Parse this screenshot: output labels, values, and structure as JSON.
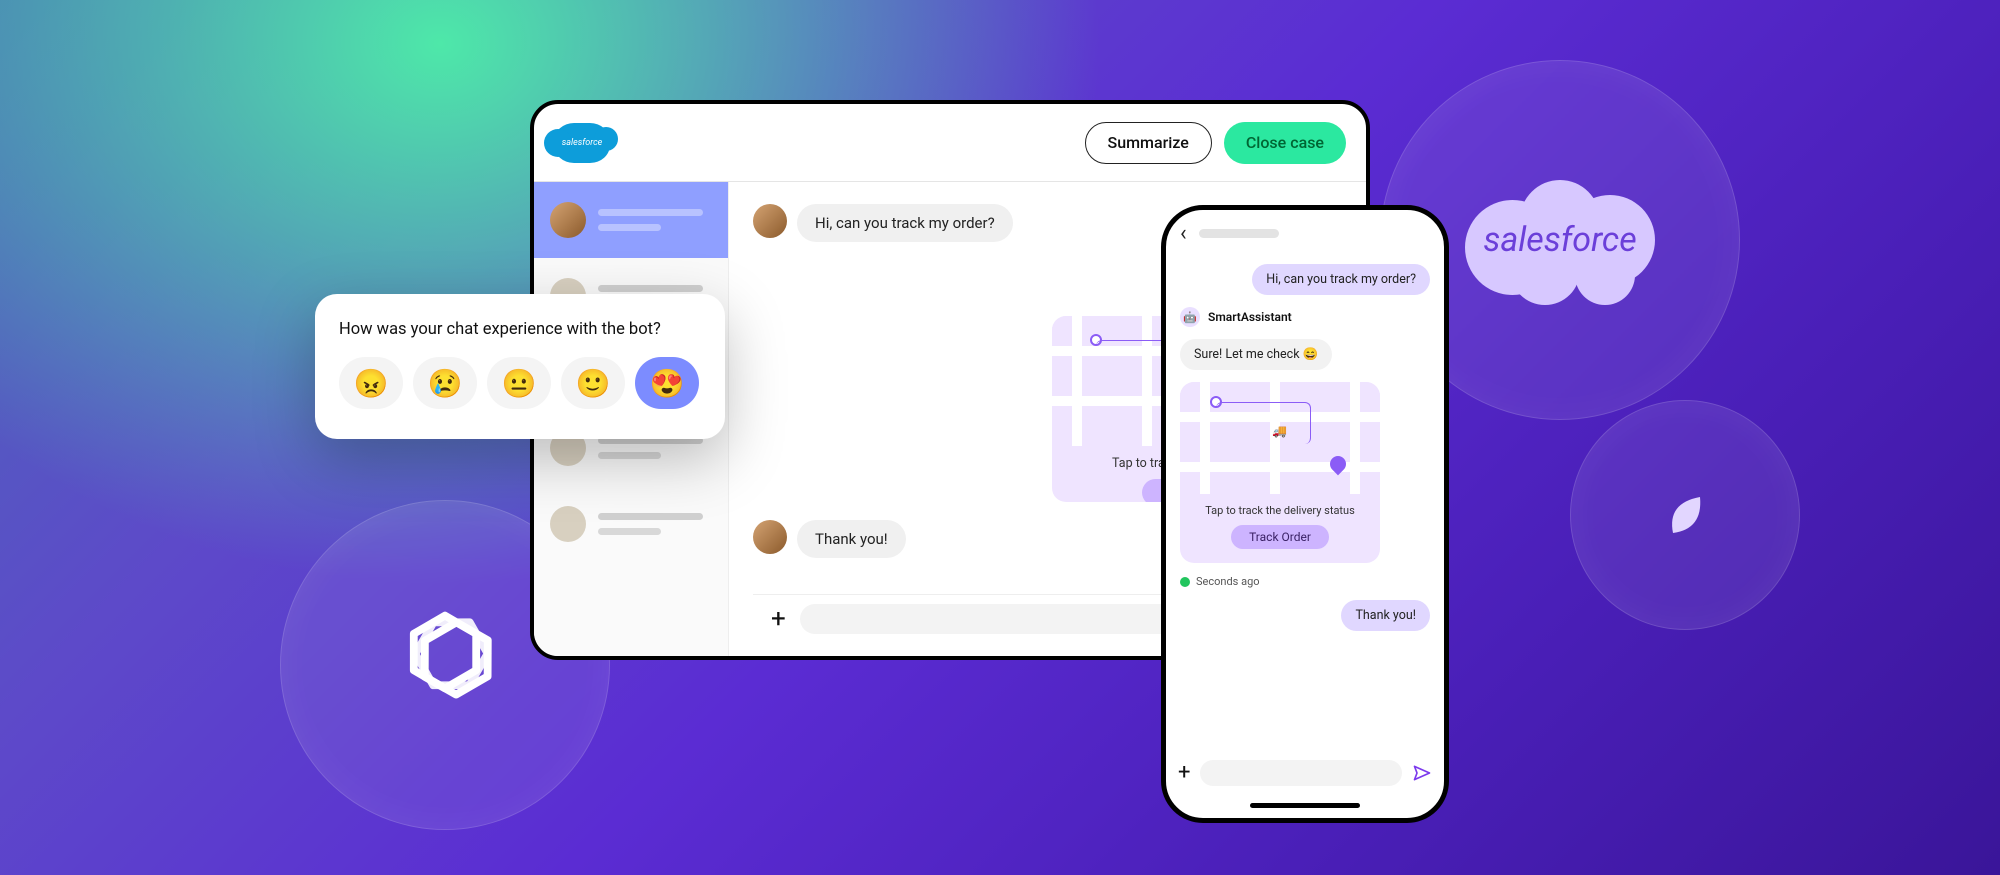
{
  "brand": {
    "salesforce_small": "salesforce",
    "salesforce_word": "salesforce"
  },
  "desktop": {
    "header": {
      "summarize": "Summarize",
      "close_case": "Close case"
    },
    "chat": {
      "user_msg_1": "Hi, can you track my order?",
      "bot_msg_1": "Sure! Let me check",
      "map_tap_text": "Tap to track the delivery status",
      "track_button": "Track Order",
      "user_msg_2": "Thank you!"
    }
  },
  "feedback": {
    "title": "How was your chat experience with the bot?",
    "emojis": [
      "😠",
      "😢",
      "😐",
      "🙂",
      "😍"
    ],
    "selected_index": 4
  },
  "phone": {
    "bot_name": "SmartAssistant",
    "user_msg_1": "Hi, can you track my order?",
    "bot_msg_1": "Sure! Let me check 😄",
    "map_tap_text": "Tap to track the delivery status",
    "track_button": "Track Order",
    "timestamp": "Seconds ago",
    "user_msg_2": "Thank you!"
  }
}
